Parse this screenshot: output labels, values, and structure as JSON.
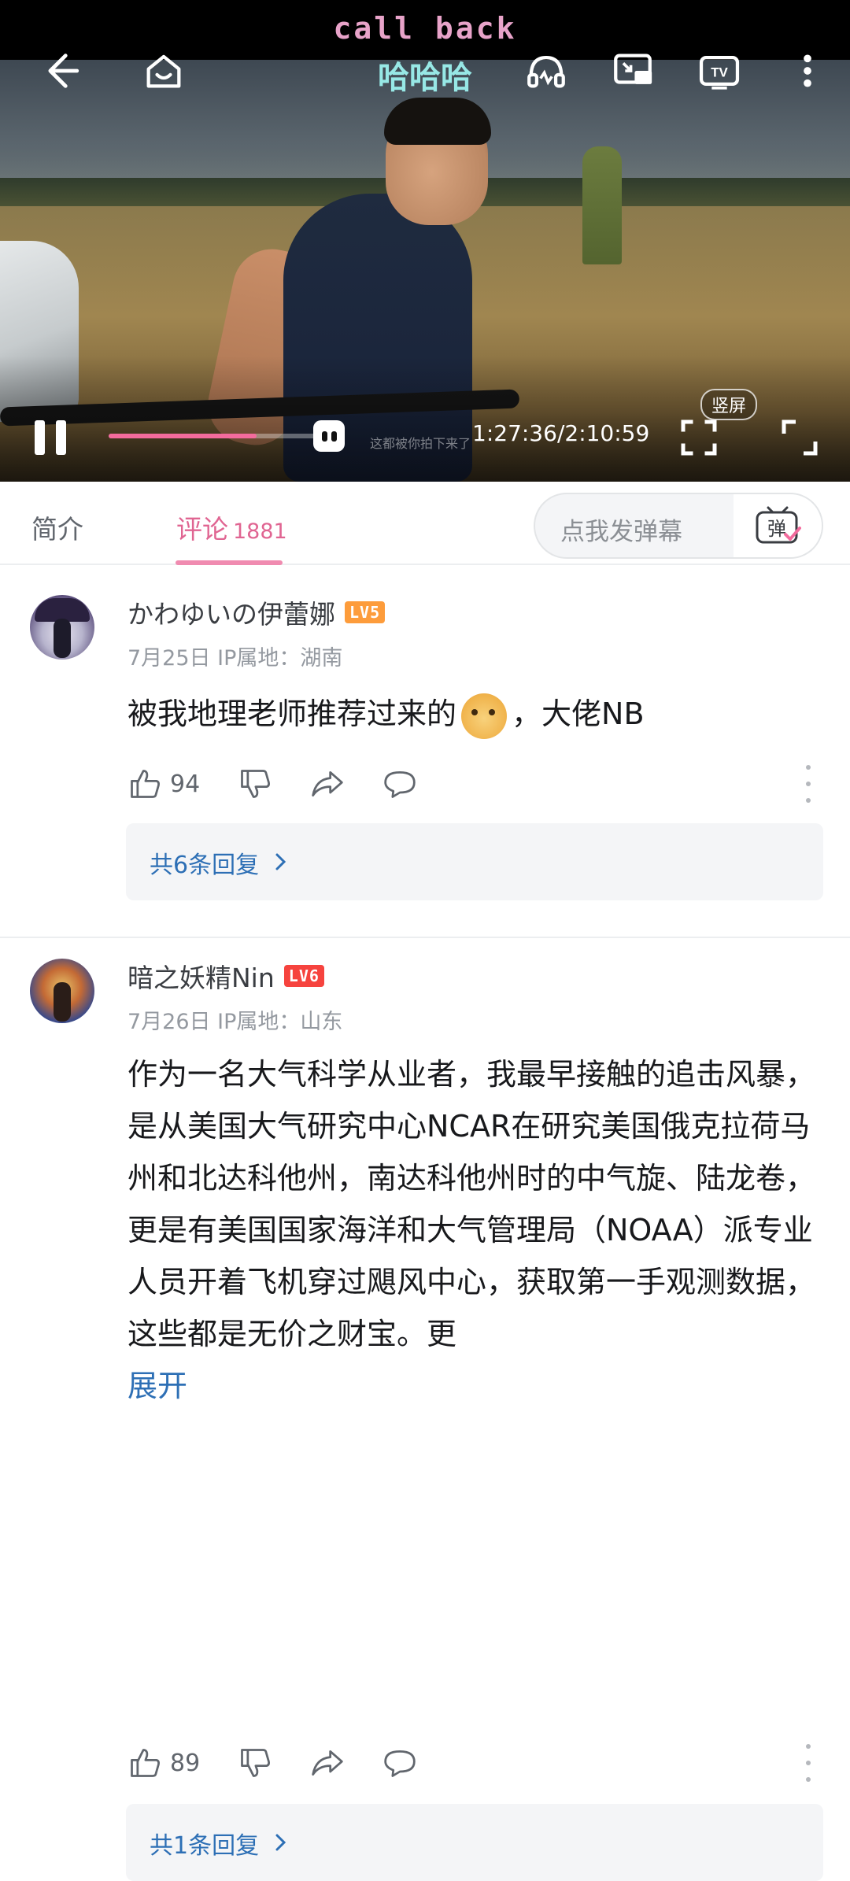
{
  "player": {
    "danmaku": [
      "call back",
      "哈哈哈"
    ],
    "hint_text": "这都被你拍下来了",
    "time": "1:27:36/2:10:59",
    "progress": 0.67,
    "vertical_label": "竖屏",
    "icons": [
      "back-arrow-icon",
      "home-icon",
      "headphones-icon",
      "cast-screen-icon",
      "tv-icon",
      "more-vertical-icon",
      "pause-icon",
      "fullscreen-icon",
      "expand-icon"
    ]
  },
  "tabs": {
    "intro": "简介",
    "comments": "评论",
    "comments_count": "1881",
    "danmaku_placeholder": "点我发弹幕",
    "danmaku_toggle_label": "弹"
  },
  "comments": [
    {
      "username": "かわゆいの伊蕾娜",
      "level": "LV5",
      "date_ip": "7月25日 IP属地：湖南",
      "text_before_emoji": "被我地理老师推荐过来的",
      "text_after_emoji": "，大佬NB",
      "likes": "94",
      "replies": "共6条回复"
    },
    {
      "username": "暗之妖精Nin",
      "level": "LV6",
      "date_ip": "7月26日 IP属地：山东",
      "text": "作为一名大气科学从业者，我最早接触的追击风暴，是从美国大气研究中心NCAR在研究美国俄克拉荷马州和北达科他州，南达科他州时的中气旋、陆龙卷，更是有美国国家海洋和大气管理局（NOAA）派专业人员开着飞机穿过飓风中心，获取第一手观测数据，这些都是无价之财宝。更",
      "expand": "展开",
      "likes": "89",
      "replies": "共1条回复"
    }
  ],
  "colors": {
    "accent_pink": "#e06592",
    "link_blue": "#2d6fb5",
    "progress": "#f36b9d"
  }
}
